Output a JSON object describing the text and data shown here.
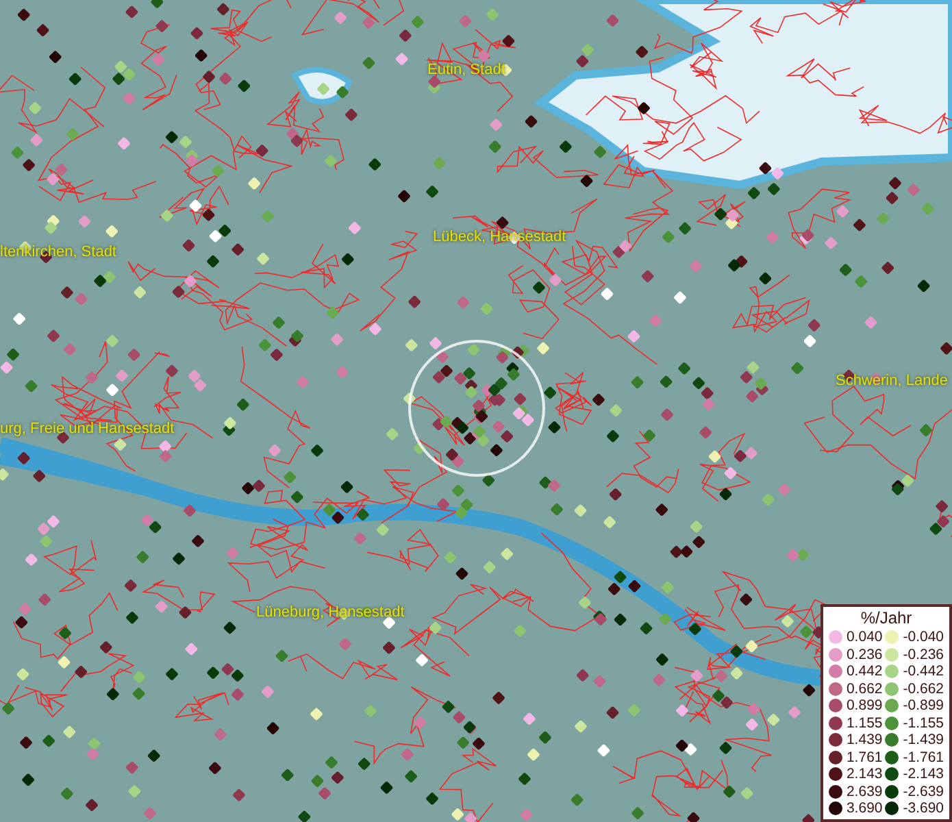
{
  "map": {
    "place_labels": [
      {
        "text": "Eutin, Stadt"
      },
      {
        "text": "Lübeck, Hansestadt"
      },
      {
        "text": "ltenkirchen, Stadt"
      },
      {
        "text": "Schwerin, Lande"
      },
      {
        "text": "urg, Freie und Hansestadt"
      },
      {
        "text": "Lüneburg, Hansestadt"
      }
    ]
  },
  "legend": {
    "title": "%/Jahr",
    "columns": [
      {
        "entries": [
          {
            "value": "0.040",
            "color": "#f4b8e6"
          },
          {
            "value": "0.236",
            "color": "#e49cc8"
          },
          {
            "value": "0.442",
            "color": "#d27ca6"
          },
          {
            "value": "0.662",
            "color": "#c06888"
          },
          {
            "value": "0.899",
            "color": "#a84c6a"
          },
          {
            "value": "1.155",
            "color": "#903850"
          },
          {
            "value": "1.439",
            "color": "#7a2a3c"
          },
          {
            "value": "1.761",
            "color": "#66202c"
          },
          {
            "value": "2.143",
            "color": "#501418"
          },
          {
            "value": "2.639",
            "color": "#3a0c10"
          },
          {
            "value": "3.690",
            "color": "#240606"
          }
        ]
      },
      {
        "entries": [
          {
            "value": "-0.040",
            "color": "#eef2b0"
          },
          {
            "value": "-0.236",
            "color": "#cce6a0"
          },
          {
            "value": "-0.442",
            "color": "#a8d488"
          },
          {
            "value": "-0.662",
            "color": "#8cc470"
          },
          {
            "value": "-0.899",
            "color": "#6aaa50"
          },
          {
            "value": "-1.155",
            "color": "#4c9238"
          },
          {
            "value": "-1.439",
            "color": "#387c2c"
          },
          {
            "value": "-1.761",
            "color": "#1e5e1a"
          },
          {
            "value": "-2.143",
            "color": "#104a10"
          },
          {
            "value": "-2.639",
            "color": "#0a3a0a"
          },
          {
            "value": "-3.690",
            "color": "#062806"
          }
        ]
      }
    ]
  }
}
